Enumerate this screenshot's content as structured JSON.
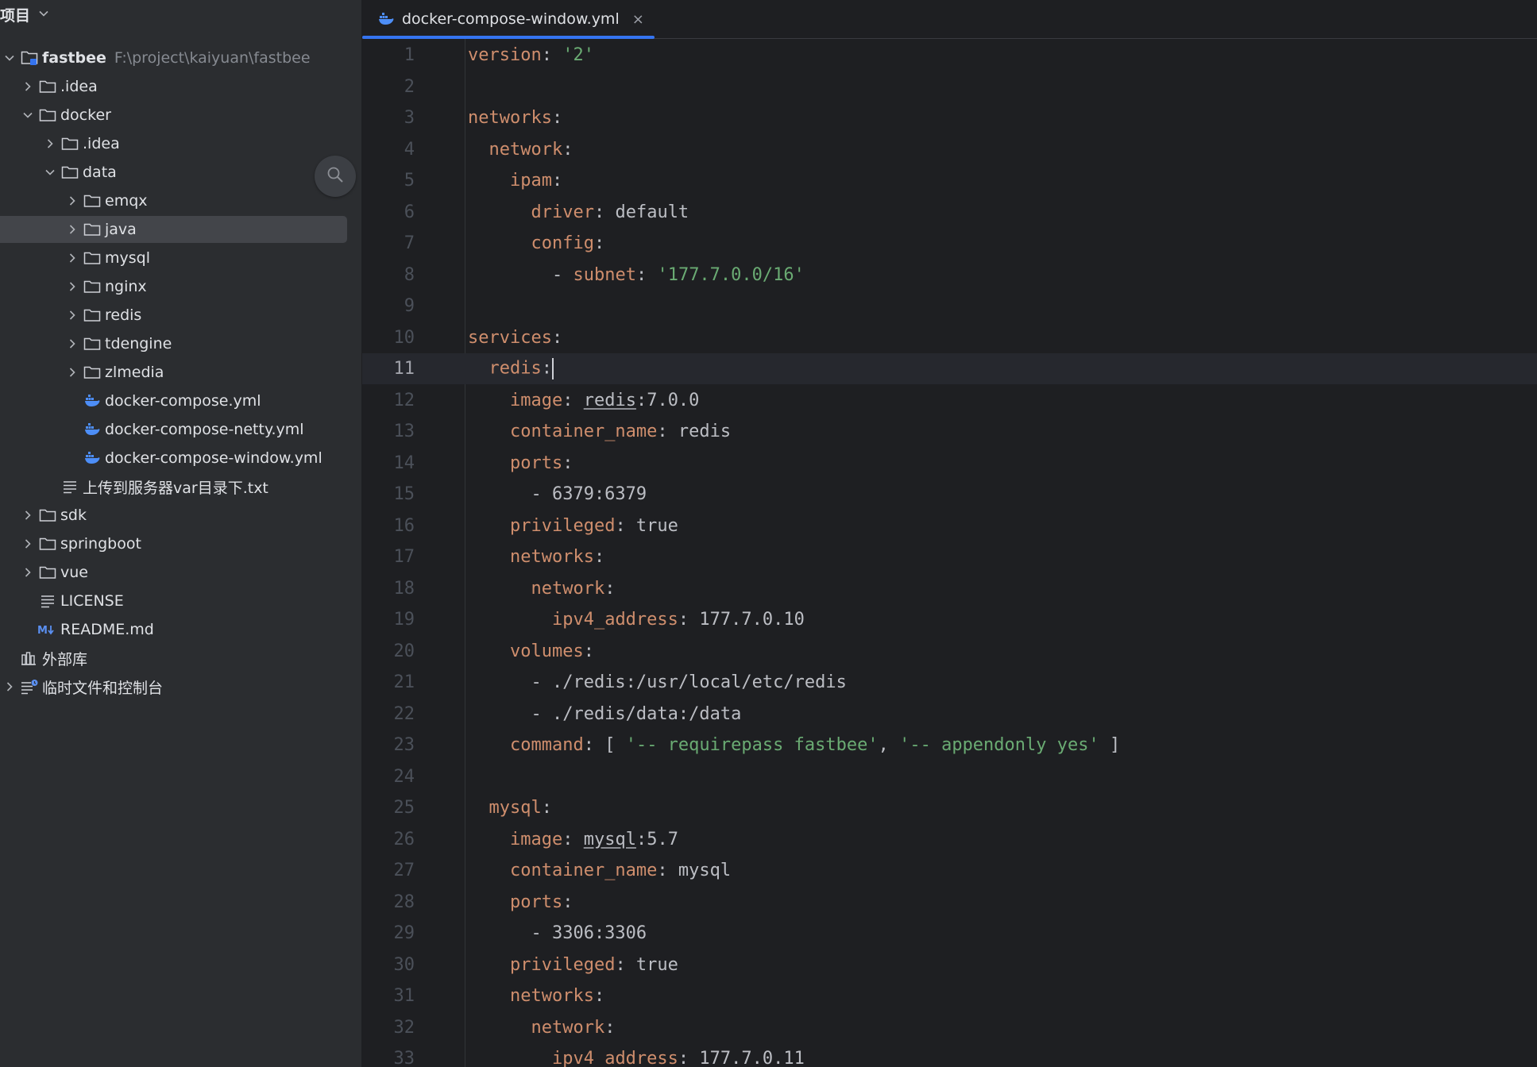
{
  "sidebar": {
    "title": "项目",
    "tree": [
      {
        "label": "fastbee",
        "path": "F:\\project\\kaiyuan\\fastbee",
        "icon": "module-folder-icon",
        "arrow": "expanded"
      },
      {
        "label": ".idea",
        "icon": "folder-icon",
        "arrow": "collapsed"
      },
      {
        "label": "docker",
        "icon": "folder-icon",
        "arrow": "expanded"
      },
      {
        "label": ".idea",
        "icon": "folder-icon",
        "arrow": "collapsed"
      },
      {
        "label": "data",
        "icon": "folder-icon",
        "arrow": "expanded"
      },
      {
        "label": "emqx",
        "icon": "folder-icon",
        "arrow": "collapsed"
      },
      {
        "label": "java",
        "icon": "folder-icon",
        "arrow": "collapsed",
        "selected": true
      },
      {
        "label": "mysql",
        "icon": "folder-icon",
        "arrow": "collapsed"
      },
      {
        "label": "nginx",
        "icon": "folder-icon",
        "arrow": "collapsed"
      },
      {
        "label": "redis",
        "icon": "folder-icon",
        "arrow": "collapsed"
      },
      {
        "label": "tdengine",
        "icon": "folder-icon",
        "arrow": "collapsed"
      },
      {
        "label": "zlmedia",
        "icon": "folder-icon",
        "arrow": "collapsed"
      },
      {
        "label": "docker-compose.yml",
        "icon": "docker-icon"
      },
      {
        "label": "docker-compose-netty.yml",
        "icon": "docker-icon"
      },
      {
        "label": "docker-compose-window.yml",
        "icon": "docker-icon"
      },
      {
        "label": "上传到服务器var目录下.txt",
        "icon": "text-file-icon"
      },
      {
        "label": "sdk",
        "icon": "folder-icon",
        "arrow": "collapsed"
      },
      {
        "label": "springboot",
        "icon": "folder-icon",
        "arrow": "collapsed"
      },
      {
        "label": "vue",
        "icon": "folder-icon",
        "arrow": "collapsed"
      },
      {
        "label": "LICENSE",
        "icon": "text-file-icon"
      },
      {
        "label": "README.md",
        "icon": "markdown-icon"
      },
      {
        "label": "外部库",
        "icon": "library-icon"
      },
      {
        "label": "临时文件和控制台",
        "icon": "scratches-icon",
        "arrow": "collapsed"
      }
    ]
  },
  "editor": {
    "tab": {
      "label": "docker-compose-window.yml",
      "close": "×"
    },
    "current_line": 11,
    "lines": [
      {
        "n": "1",
        "text": "version: '2'"
      },
      {
        "n": "2",
        "text": ""
      },
      {
        "n": "3",
        "text": "networks:"
      },
      {
        "n": "4",
        "text": "  network:"
      },
      {
        "n": "5",
        "text": "    ipam:"
      },
      {
        "n": "6",
        "text": "      driver: default"
      },
      {
        "n": "7",
        "text": "      config:"
      },
      {
        "n": "8",
        "text": "        - subnet: '177.7.0.0/16'"
      },
      {
        "n": "9",
        "text": ""
      },
      {
        "n": "10",
        "text": "services:"
      },
      {
        "n": "11",
        "text": "  redis:"
      },
      {
        "n": "12",
        "text": "    image: redis:7.0.0"
      },
      {
        "n": "13",
        "text": "    container_name: redis"
      },
      {
        "n": "14",
        "text": "    ports:"
      },
      {
        "n": "15",
        "text": "      - 6379:6379"
      },
      {
        "n": "16",
        "text": "    privileged: true"
      },
      {
        "n": "17",
        "text": "    networks:"
      },
      {
        "n": "18",
        "text": "      network:"
      },
      {
        "n": "19",
        "text": "        ipv4_address: 177.7.0.10"
      },
      {
        "n": "20",
        "text": "    volumes:"
      },
      {
        "n": "21",
        "text": "      - ./redis:/usr/local/etc/redis"
      },
      {
        "n": "22",
        "text": "      - ./redis/data:/data"
      },
      {
        "n": "23",
        "text": "    command: [ '-- requirepass fastbee', '-- appendonly yes' ]"
      },
      {
        "n": "24",
        "text": ""
      },
      {
        "n": "25",
        "text": "  mysql:"
      },
      {
        "n": "26",
        "text": "    image: mysql:5.7"
      },
      {
        "n": "27",
        "text": "    container_name: mysql"
      },
      {
        "n": "28",
        "text": "    ports:"
      },
      {
        "n": "29",
        "text": "      - 3306:3306"
      },
      {
        "n": "30",
        "text": "    privileged: true"
      },
      {
        "n": "31",
        "text": "    networks:"
      },
      {
        "n": "32",
        "text": "      network:"
      },
      {
        "n": "33",
        "text": "        ipv4_address: 177.7.0.11"
      }
    ]
  },
  "colors": {
    "sidebar_bg": "#2b2d30",
    "editor_bg": "#1e1f22",
    "selection": "#43454a",
    "accent": "#3574f0",
    "yaml_key": "#cf8e6d",
    "yaml_string": "#6aab73",
    "text": "#bcbec4",
    "line_number": "#4b5059"
  }
}
